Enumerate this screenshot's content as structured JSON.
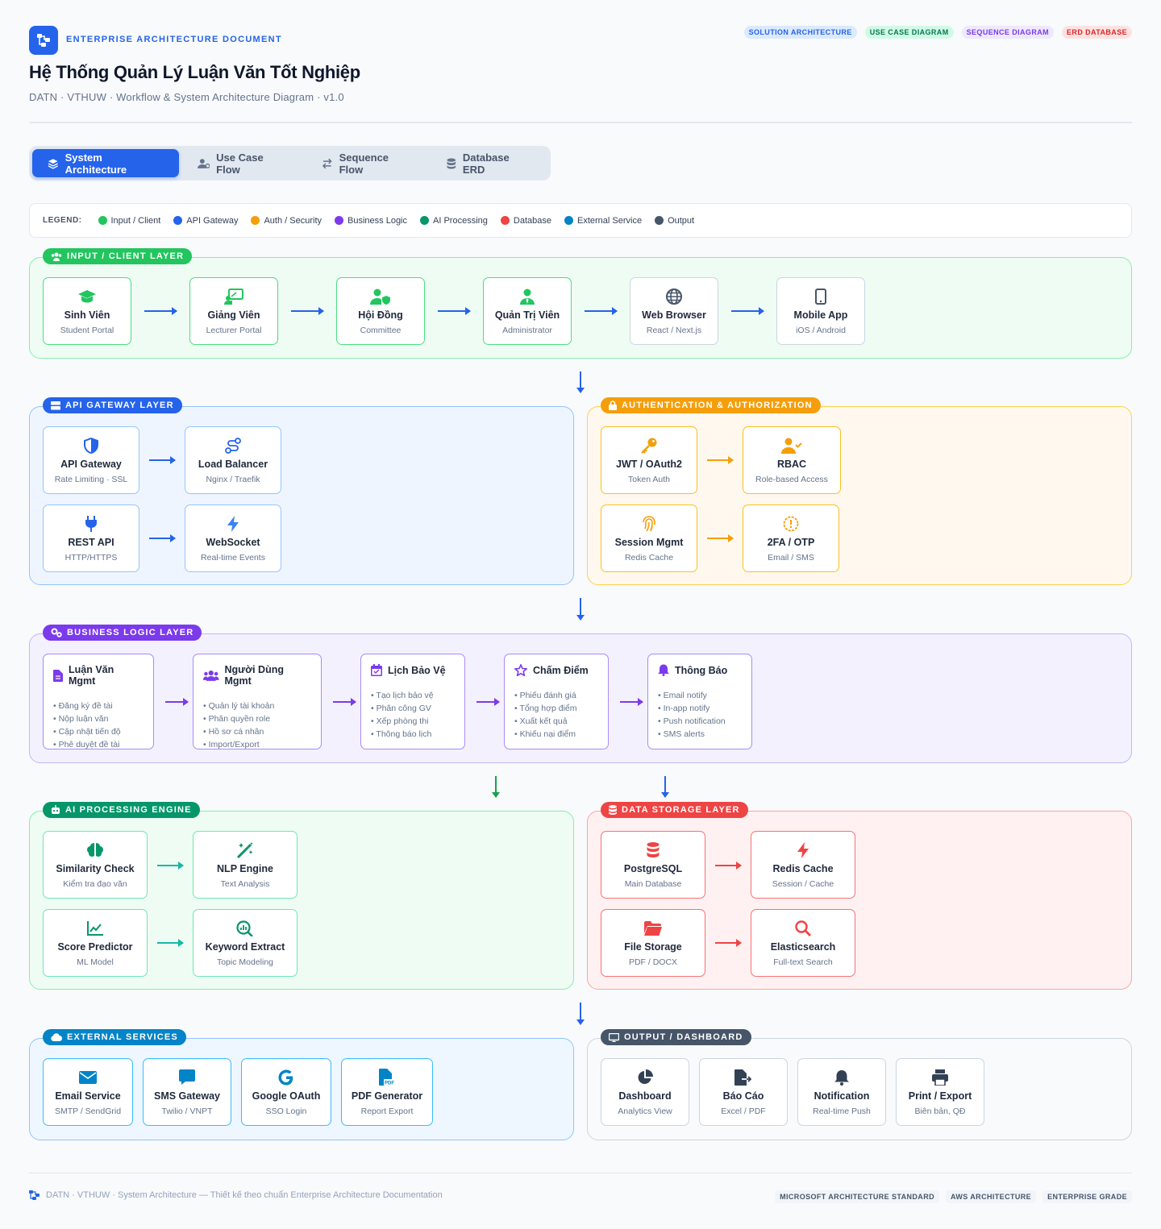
{
  "header": {
    "doc_label": "ENTERPRISE ARCHITECTURE DOCUMENT",
    "title": "Hệ Thống Quản Lý Luận Văn Tốt Nghiệp",
    "subtitle": "DATN · VTHUW · Workflow & System Architecture Diagram · v1.0",
    "badges": [
      {
        "label": "SOLUTION ARCHITECTURE",
        "color": "#2563eb",
        "bg": "#dbeafe"
      },
      {
        "label": "USE CASE DIAGRAM",
        "color": "#047857",
        "bg": "#d1fae5"
      },
      {
        "label": "SEQUENCE DIAGRAM",
        "color": "#7c3aed",
        "bg": "#ede9fe"
      },
      {
        "label": "ERD DATABASE",
        "color": "#dc2626",
        "bg": "#fee2e2"
      }
    ]
  },
  "tabs": [
    {
      "label": "System Architecture",
      "icon": "layers-icon",
      "active": true
    },
    {
      "label": "Use Case Flow",
      "icon": "users-cog-icon"
    },
    {
      "label": "Sequence Flow",
      "icon": "exchange-icon"
    },
    {
      "label": "Database ERD",
      "icon": "database-icon"
    }
  ],
  "legend": {
    "title": "LEGEND:",
    "items": [
      {
        "label": "Input / Client",
        "color": "#22c55e"
      },
      {
        "label": "API Gateway",
        "color": "#2563eb"
      },
      {
        "label": "Auth / Security",
        "color": "#f59e0b"
      },
      {
        "label": "Business Logic",
        "color": "#7c3aed"
      },
      {
        "label": "AI Processing",
        "color": "#059669"
      },
      {
        "label": "Database",
        "color": "#ef4444"
      },
      {
        "label": "External Service",
        "color": "#0284c7"
      },
      {
        "label": "Output",
        "color": "#475569"
      }
    ]
  },
  "layers": {
    "input": {
      "tag": "INPUT / CLIENT LAYER",
      "color": "#22c55e",
      "nodes": [
        {
          "title": "Sinh Viên",
          "sub": "Student Portal",
          "icon": "graduation-cap-icon"
        },
        {
          "title": "Giảng Viên",
          "sub": "Lecturer Portal",
          "icon": "chalkboard-teacher-icon"
        },
        {
          "title": "Hội Đồng",
          "sub": "Committee",
          "icon": "user-shield-icon"
        },
        {
          "title": "Quản Trị Viên",
          "sub": "Administrator",
          "icon": "user-tie-icon"
        },
        {
          "title": "Web Browser",
          "sub": "React / Next.js",
          "icon": "globe-icon"
        },
        {
          "title": "Mobile App",
          "sub": "iOS / Android",
          "icon": "mobile-icon"
        }
      ]
    },
    "gateway": {
      "tag": "API GATEWAY LAYER",
      "color": "#2563eb",
      "nodes": [
        {
          "title": "API Gateway",
          "sub": "Rate Limiting · SSL",
          "icon": "shield-icon"
        },
        {
          "title": "Load Balancer",
          "sub": "Nginx / Traefik",
          "icon": "route-icon"
        },
        {
          "title": "REST API",
          "sub": "HTTP/HTTPS",
          "icon": "plug-icon"
        },
        {
          "title": "WebSocket",
          "sub": "Real-time Events",
          "icon": "bolt-icon"
        }
      ]
    },
    "auth": {
      "tag": "AUTHENTICATION & AUTHORIZATION",
      "color": "#f59e0b",
      "nodes": [
        {
          "title": "JWT / OAuth2",
          "sub": "Token Auth",
          "icon": "key-icon"
        },
        {
          "title": "RBAC",
          "sub": "Role-based Access",
          "icon": "user-check-icon"
        },
        {
          "title": "Session Mgmt",
          "sub": "Redis Cache",
          "icon": "fingerprint-icon"
        },
        {
          "title": "2FA / OTP",
          "sub": "Email / SMS",
          "icon": "alert-circle-icon"
        }
      ]
    },
    "business": {
      "tag": "BUSINESS LOGIC LAYER",
      "color": "#7c3aed",
      "modules": [
        {
          "title": "Luận Văn Mgmt",
          "icon": "file-icon",
          "items": [
            "Đăng ký đề tài",
            "Nộp luận văn",
            "Cập nhật tiến độ",
            "Phê duyệt đề tài"
          ]
        },
        {
          "title": "Người Dùng Mgmt",
          "icon": "users-icon",
          "items": [
            "Quản lý tài khoản",
            "Phân quyền role",
            "Hồ sơ cá nhân",
            "Import/Export"
          ]
        },
        {
          "title": "Lịch Bảo Vệ",
          "icon": "calendar-icon",
          "items": [
            "Tạo lịch bảo vệ",
            "Phân công GV",
            "Xếp phòng thi",
            "Thông báo lịch"
          ]
        },
        {
          "title": "Chấm Điểm",
          "icon": "star-icon",
          "items": [
            "Phiếu đánh giá",
            "Tổng hợp điểm",
            "Xuất kết quả",
            "Khiếu nại điểm"
          ]
        },
        {
          "title": "Thông Báo",
          "icon": "bell-icon",
          "items": [
            "Email notify",
            "In-app notify",
            "Push notification",
            "SMS alerts"
          ]
        }
      ]
    },
    "ai": {
      "tag": "AI PROCESSING ENGINE",
      "color": "#059669",
      "nodes": [
        {
          "title": "Similarity Check",
          "sub": "Kiểm tra đạo văn",
          "icon": "brain-icon"
        },
        {
          "title": "NLP Engine",
          "sub": "Text Analysis",
          "icon": "magic-wand-icon"
        },
        {
          "title": "Score Predictor",
          "sub": "ML Model",
          "icon": "chart-line-icon"
        },
        {
          "title": "Keyword Extract",
          "sub": "Topic Modeling",
          "icon": "search-chart-icon"
        }
      ]
    },
    "storage": {
      "tag": "DATA STORAGE LAYER",
      "color": "#ef4444",
      "nodes": [
        {
          "title": "PostgreSQL",
          "sub": "Main Database",
          "icon": "database-icon"
        },
        {
          "title": "Redis Cache",
          "sub": "Session / Cache",
          "icon": "bolt-icon"
        },
        {
          "title": "File Storage",
          "sub": "PDF / DOCX",
          "icon": "folder-icon"
        },
        {
          "title": "Elasticsearch",
          "sub": "Full-text Search",
          "icon": "search-icon"
        }
      ]
    },
    "external": {
      "tag": "EXTERNAL SERVICES",
      "color": "#0284c7",
      "nodes": [
        {
          "title": "Email Service",
          "sub": "SMTP / SendGrid",
          "icon": "envelope-icon"
        },
        {
          "title": "SMS Gateway",
          "sub": "Twilio / VNPT",
          "icon": "chat-icon"
        },
        {
          "title": "Google OAuth",
          "sub": "SSO Login",
          "icon": "google-icon"
        },
        {
          "title": "PDF Generator",
          "sub": "Report Export",
          "icon": "pdf-icon"
        }
      ]
    },
    "output": {
      "tag": "OUTPUT / DASHBOARD",
      "color": "#475569",
      "nodes": [
        {
          "title": "Dashboard",
          "sub": "Analytics View",
          "icon": "pie-chart-icon"
        },
        {
          "title": "Báo Cáo",
          "sub": "Excel / PDF",
          "icon": "file-export-icon"
        },
        {
          "title": "Notification",
          "sub": "Real-time Push",
          "icon": "bell-icon"
        },
        {
          "title": "Print / Export",
          "sub": "Biên bản, QĐ",
          "icon": "print-icon"
        }
      ]
    }
  },
  "footer": {
    "text": "DATN · VTHUW · System Architecture — Thiết kế theo chuẩn Enterprise Architecture Documentation",
    "badges": [
      "MICROSOFT ARCHITECTURE STANDARD",
      "AWS ARCHITECTURE",
      "ENTERPRISE GRADE"
    ]
  }
}
